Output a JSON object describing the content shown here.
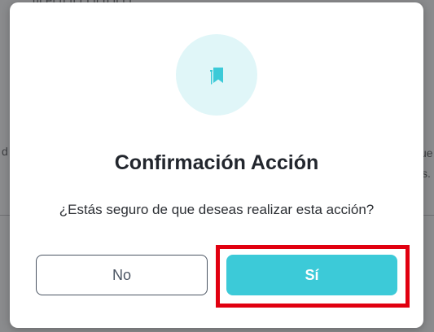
{
  "background": {
    "top_text": "ul el   ú  fl   t l   ll   b               ll    l    t",
    "left_fragment": "d",
    "right_fragment_1": "ue",
    "right_fragment_2": "s."
  },
  "dialog": {
    "icon": "bookmarks-icon",
    "title": "Confirmación Acción",
    "message": "¿Estás seguro de que deseas realizar esta acción?",
    "no_label": "No",
    "yes_label": "Sí"
  },
  "colors": {
    "accent": "#3ccad8",
    "icon_bg": "#e0f6f8",
    "highlight": "#e10010"
  }
}
